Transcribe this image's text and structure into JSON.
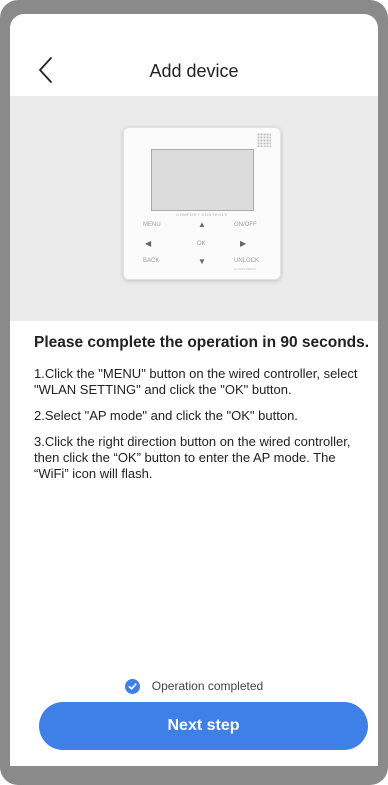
{
  "header": {
    "title": "Add device",
    "back_icon": "chevron-left-icon"
  },
  "controller_image": {
    "brand": "COMFORT CONTROLS",
    "labels": {
      "menu": "MENU",
      "on_off": "ON/OFF",
      "ok": "OK",
      "back": "BACK",
      "unlock": "UNLOCK",
      "unlock_sub": "3 LONG PRESS"
    }
  },
  "instructions": {
    "heading": "Please complete the operation in 90 seconds.",
    "steps": [
      "1.Click the \"MENU\" button on the wired controller, select \"WLAN SETTING\" and click the \"OK\" button.",
      "2.Select \"AP mode\" and click the \"OK\" button.",
      "3.Click the right direction button on the wired controller, then click the “OK” button to enter the AP mode. The “WiFi” icon will flash."
    ]
  },
  "confirm": {
    "label": "Operation completed",
    "checked": true,
    "icon": "checkmark-icon"
  },
  "footer": {
    "next_label": "Next step"
  },
  "colors": {
    "accent": "#3f7fe8",
    "frame": "#8a8a8a",
    "image_bg": "#ebebeb"
  }
}
